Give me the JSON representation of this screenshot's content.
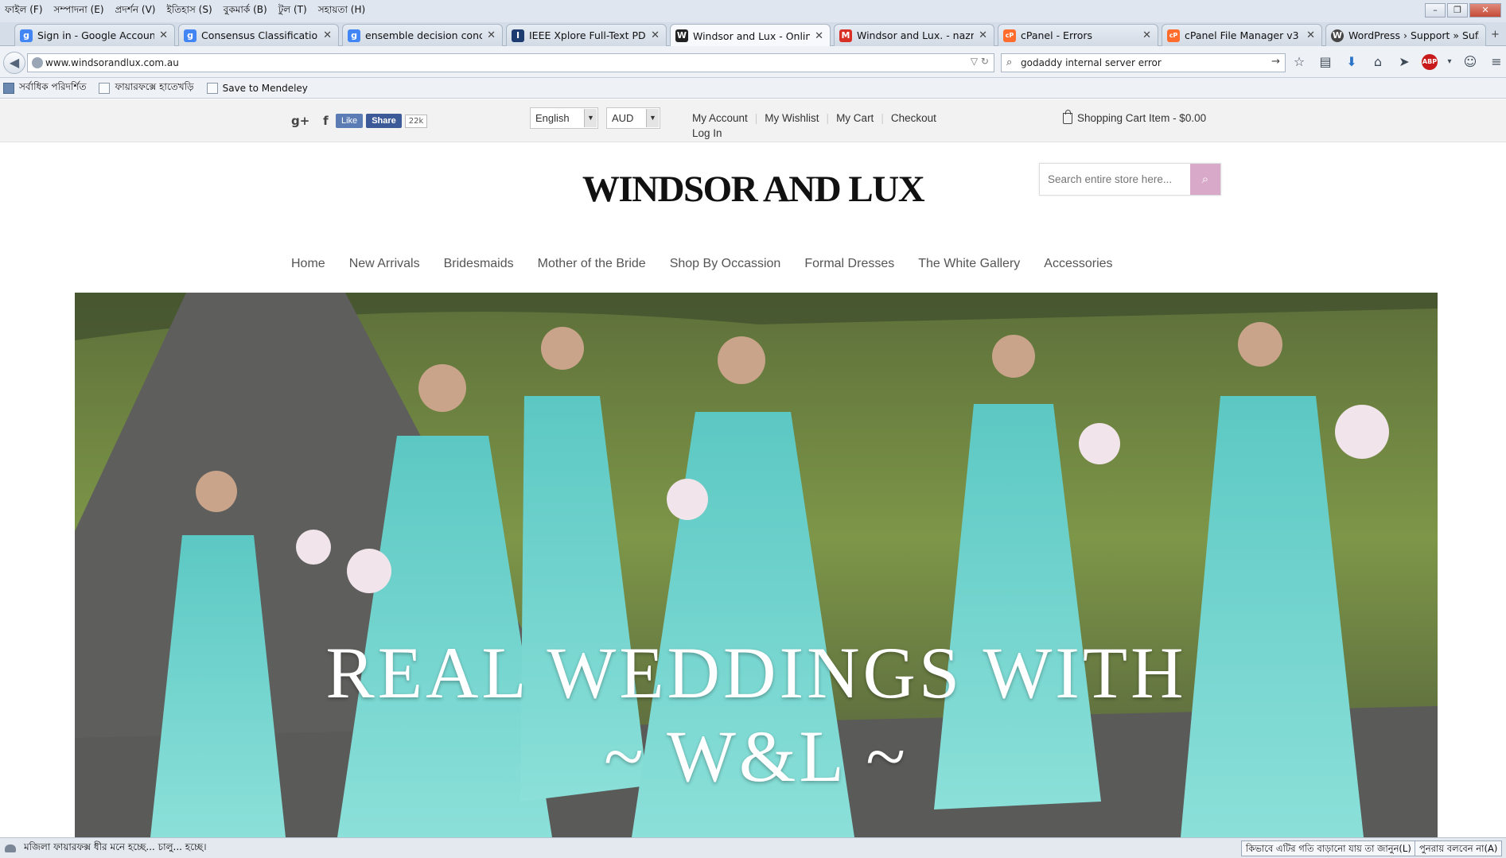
{
  "menubar": [
    "ফাইল (F)",
    "সম্পাদনা (E)",
    "প্রদর্শন (V)",
    "ইতিহাস (S)",
    "বুকমার্ক (B)",
    "টুল (T)",
    "সহায়তা (H)"
  ],
  "tabs": [
    {
      "title": "Sign in - Google Accounts",
      "icon": "google-icon",
      "color": "#4285f4"
    },
    {
      "title": "Consensus Classification ...",
      "icon": "google-icon",
      "color": "#4285f4"
    },
    {
      "title": "ensemble decision conce...",
      "icon": "google-icon",
      "color": "#4285f4"
    },
    {
      "title": "IEEE Xplore Full-Text PDF:",
      "icon": "ieee-icon",
      "color": "#1d3c70"
    },
    {
      "title": "Windsor and Lux - Online ...",
      "icon": "windsor-icon",
      "color": "#222222"
    },
    {
      "title": "Windsor and Lux. - nazmu...",
      "icon": "gmail-icon",
      "color": "#d93025"
    },
    {
      "title": "cPanel - Errors",
      "icon": "cpanel-icon",
      "color": "#ff6c2c"
    },
    {
      "title": "cPanel File Manager v3",
      "icon": "cpanel-icon",
      "color": "#ff6c2c"
    },
    {
      "title": "WordPress › Support » Suf...",
      "icon": "wordpress-icon",
      "color": "#464646"
    }
  ],
  "tab_glyphs": [
    "g",
    "g",
    "g",
    "I",
    "W",
    "M",
    "cP",
    "cP",
    "W"
  ],
  "address": {
    "url": "www.windsorandlux.com.au"
  },
  "search": {
    "query": "godaddy internal server error"
  },
  "bookmarks": [
    "সর্বাধিক পরিদর্শিত",
    "ফায়ারফক্সে হাতেখড়ি",
    "Save to Mendeley"
  ],
  "page": {
    "social": {
      "gplus": "g+",
      "facebook": "f",
      "like": "Like",
      "share": "Share",
      "count": "22k"
    },
    "language": "English",
    "currency": "AUD",
    "account_links": [
      "My Account",
      "My Wishlist",
      "My Cart",
      "Checkout"
    ],
    "login": "Log In",
    "cart": "Shopping Cart Item - $0.00",
    "logo": "WINDSOR AND LUX",
    "store_search_placeholder": "Search entire store here...",
    "nav": [
      "Home",
      "New Arrivals",
      "Bridesmaids",
      "Mother of the Bride",
      "Shop By Occassion",
      "Formal Dresses",
      "The White Gallery",
      "Accessories"
    ],
    "hero": {
      "line1": "REAL WEDDINGS WITH",
      "line2": "~ W&L ~"
    }
  },
  "status": {
    "text": "মজিলা ফায়ারফক্স ধীর মনে হচ্ছে... চালু... হচ্ছে।",
    "button1": "কিভাবে এটির গতি বাড়ানো যায় তা জানুন(L)",
    "button2": "পুনরায় বলবেন না(A)"
  },
  "colors": {
    "accent_search": "#d9a9c9",
    "dress": "#6fd3cc"
  }
}
